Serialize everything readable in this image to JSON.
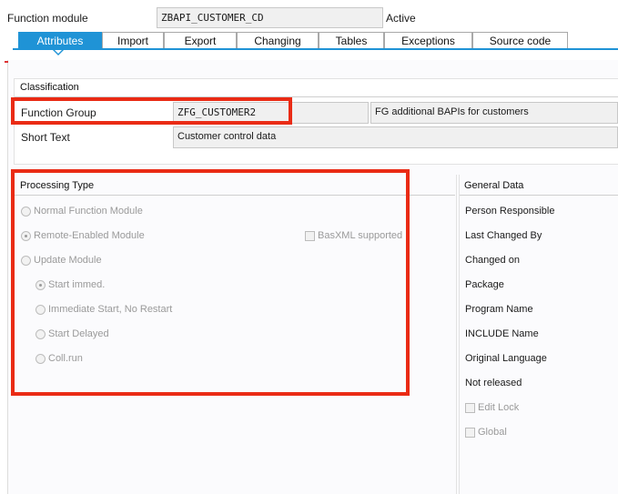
{
  "header": {
    "function_module_label": "Function module",
    "function_module_value": "ZBAPI_CUSTOMER_CD",
    "status": "Active"
  },
  "tabs": [
    {
      "label": "Attributes",
      "active": true
    },
    {
      "label": "Import"
    },
    {
      "label": "Export"
    },
    {
      "label": "Changing"
    },
    {
      "label": "Tables"
    },
    {
      "label": "Exceptions"
    },
    {
      "label": "Source code"
    }
  ],
  "classification": {
    "title": "Classification",
    "function_group_label": "Function Group",
    "function_group_value": "ZFG_CUSTOMER2",
    "function_group_desc": "FG additional BAPIs for customers",
    "short_text_label": "Short Text",
    "short_text_value": "Customer control data"
  },
  "processing_type": {
    "title": "Processing Type",
    "normal": "Normal Function Module",
    "remote": "Remote-Enabled Module",
    "basxml": "BasXML supported",
    "update": "Update Module",
    "start_immed": "Start immed.",
    "immediate_no_restart": "Immediate Start, No Restart",
    "start_delayed": "Start Delayed",
    "coll_run": "Coll.run"
  },
  "general_data": {
    "title": "General Data",
    "person_responsible": "Person Responsible",
    "last_changed_by": "Last Changed By",
    "changed_on": "Changed on",
    "package": "Package",
    "program_name": "Program Name",
    "include_name": "INCLUDE Name",
    "original_language": "Original Language",
    "not_released": "Not released",
    "edit_lock": "Edit Lock",
    "global": "Global"
  },
  "colors": {
    "accent": "#1f93d6",
    "highlight": "#ea2b15"
  }
}
